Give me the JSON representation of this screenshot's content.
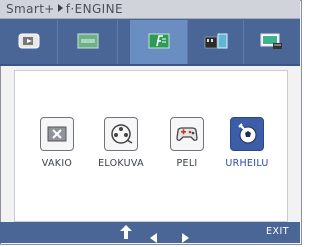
{
  "title": {
    "brand": "Smart+",
    "engine": "f·ENGINE"
  },
  "tabs": [
    {
      "icon": "input-source-icon",
      "active": false
    },
    {
      "icon": "ratio-screen-icon",
      "active": false
    },
    {
      "icon": "f-engine-icon",
      "active": true
    },
    {
      "icon": "color-adjust-icon",
      "active": false
    },
    {
      "icon": "monitor-setup-icon",
      "active": false
    }
  ],
  "modes": [
    {
      "label": "VAKIO",
      "icon": "normal-mode-icon",
      "selected": false
    },
    {
      "label": "ELOKUVA",
      "icon": "movie-mode-icon",
      "selected": false
    },
    {
      "label": "PELI",
      "icon": "game-mode-icon",
      "selected": false
    },
    {
      "label": "URHEILU",
      "icon": "sport-mode-icon",
      "selected": true
    }
  ],
  "nav": {
    "exit_label": "EXIT"
  },
  "colors": {
    "accent": "#4a6696",
    "active_tab": "#6b8ec2",
    "selected_button": "#3d5ea7"
  }
}
